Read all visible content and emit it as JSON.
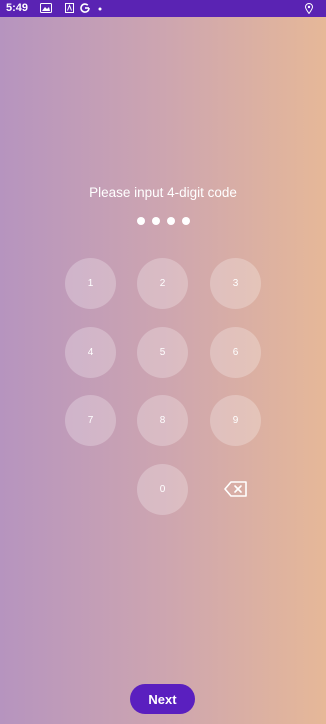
{
  "statusbar": {
    "time": "5:49"
  },
  "prompt": "Please input 4-digit code",
  "code_length": 4,
  "keys": [
    "1",
    "2",
    "3",
    "4",
    "5",
    "6",
    "7",
    "8",
    "9",
    "0"
  ],
  "next_label": "Next",
  "colors": {
    "status_bar": "#5a23b3",
    "button": "#5a1fbf",
    "gradient_left": "#b694bf",
    "gradient_right": "#e6b898"
  }
}
